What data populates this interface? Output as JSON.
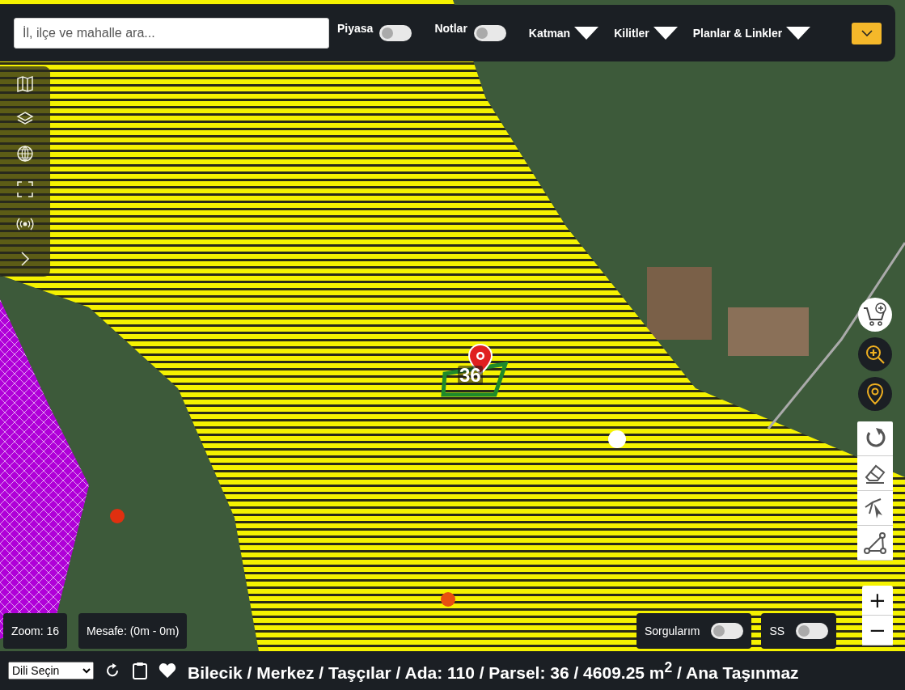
{
  "search": {
    "placeholder": "İl, ilçe ve mahalle ara..."
  },
  "toggles": [
    {
      "label": "Piyasa",
      "on": false
    },
    {
      "label": "Notlar",
      "on": false
    }
  ],
  "dropdowns": [
    {
      "label": "Katman"
    },
    {
      "label": "Kilitler"
    },
    {
      "label": "Planlar & Linkler"
    }
  ],
  "map": {
    "parcel_label": "36"
  },
  "zoom": "Zoom: 16",
  "distance": "Mesafe: (0m - 0m)",
  "bottom_toggles": [
    {
      "label": "Sorgularım",
      "on": false
    },
    {
      "label": "SS",
      "on": false
    }
  ],
  "zoom_controls": [
    "+",
    "−"
  ],
  "language_select": {
    "value": "Dili Seçin"
  },
  "breadcrumb": "Bilecik / Merkez / Taşçılar / Ada: 110 / Parsel: 36 / 4609.25 m$^{2}$ / Ana Taşınmaz"
}
